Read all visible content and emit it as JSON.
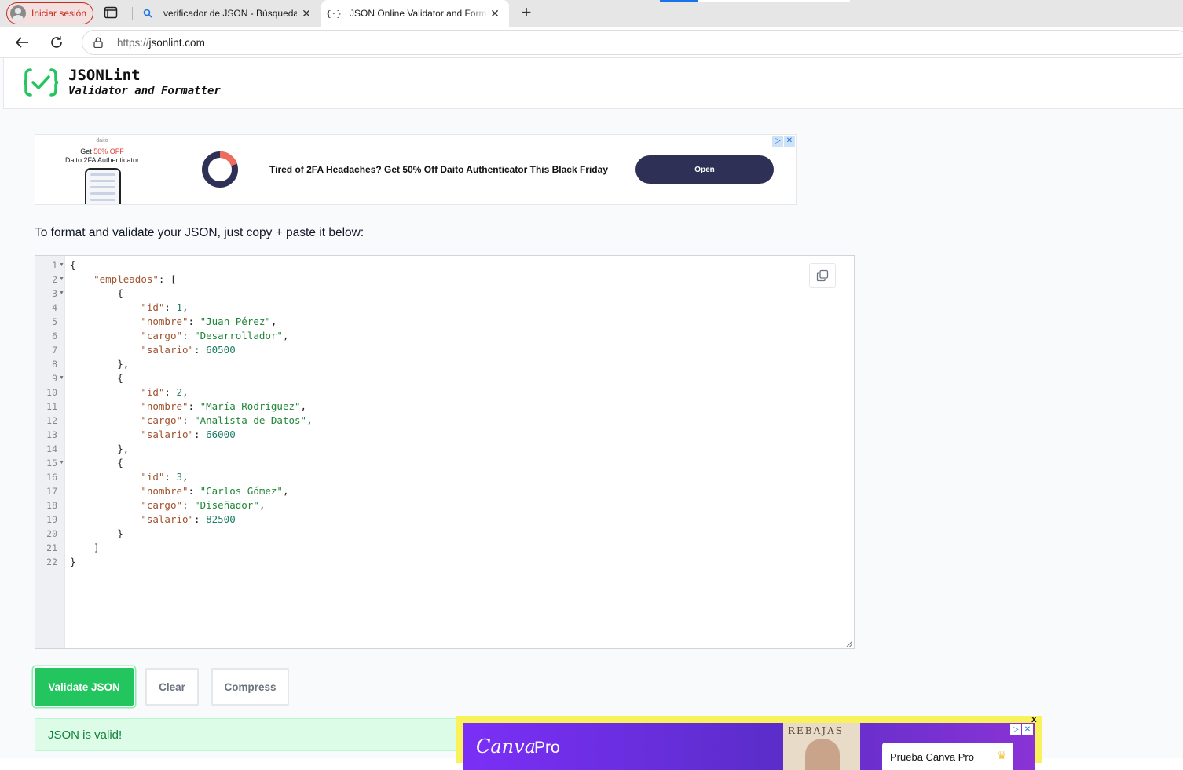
{
  "browser": {
    "profile_label": "Iniciar sesión",
    "tabs": [
      {
        "title": "verificador de JSON - Búsqueda",
        "icon": "search-icon",
        "active": false
      },
      {
        "title": "JSON Online Validator and Formatter",
        "icon": "json-braces-icon",
        "active": true
      }
    ],
    "url_scheme": "https://",
    "url_host": "jsonlint.com"
  },
  "site": {
    "name": "JSONLint",
    "tagline": "Validator and Formatter",
    "accent_color": "#22c55e"
  },
  "ad_top": {
    "brand": "daito",
    "promo_prefix": "Get ",
    "promo_highlight": "50% OFF",
    "promo_line2": "Daito 2FA Authenticator",
    "headline": "Tired of 2FA Headaches? Get 50% Off Daito Authenticator This Black Friday",
    "cta": "Open"
  },
  "instructions": "To format and validate your JSON, just copy + paste it below:",
  "editor": {
    "lines": [
      {
        "n": "1",
        "fold": true
      },
      {
        "n": "2",
        "fold": true
      },
      {
        "n": "3",
        "fold": true
      },
      {
        "n": "4"
      },
      {
        "n": "5"
      },
      {
        "n": "6"
      },
      {
        "n": "7"
      },
      {
        "n": "8"
      },
      {
        "n": "9",
        "fold": true
      },
      {
        "n": "10"
      },
      {
        "n": "11"
      },
      {
        "n": "12"
      },
      {
        "n": "13"
      },
      {
        "n": "14"
      },
      {
        "n": "15",
        "fold": true
      },
      {
        "n": "16"
      },
      {
        "n": "17"
      },
      {
        "n": "18"
      },
      {
        "n": "19"
      },
      {
        "n": "20"
      },
      {
        "n": "21"
      },
      {
        "n": "22"
      }
    ],
    "code": [
      [
        [
          "p",
          "{"
        ]
      ],
      [
        [
          "p",
          "    "
        ],
        [
          "k",
          "\"empleados\""
        ],
        [
          "p",
          ": ["
        ]
      ],
      [
        [
          "p",
          "        {"
        ]
      ],
      [
        [
          "p",
          "            "
        ],
        [
          "k",
          "\"id\""
        ],
        [
          "p",
          ": "
        ],
        [
          "n",
          "1"
        ],
        [
          "p",
          ","
        ]
      ],
      [
        [
          "p",
          "            "
        ],
        [
          "k",
          "\"nombre\""
        ],
        [
          "p",
          ": "
        ],
        [
          "s",
          "\"Juan Pérez\""
        ],
        [
          "p",
          ","
        ]
      ],
      [
        [
          "p",
          "            "
        ],
        [
          "k",
          "\"cargo\""
        ],
        [
          "p",
          ": "
        ],
        [
          "s",
          "\"Desarrollador\""
        ],
        [
          "p",
          ","
        ]
      ],
      [
        [
          "p",
          "            "
        ],
        [
          "k",
          "\"salario\""
        ],
        [
          "p",
          ": "
        ],
        [
          "n",
          "60500"
        ]
      ],
      [
        [
          "p",
          "        },"
        ]
      ],
      [
        [
          "p",
          "        {"
        ]
      ],
      [
        [
          "p",
          "            "
        ],
        [
          "k",
          "\"id\""
        ],
        [
          "p",
          ": "
        ],
        [
          "n",
          "2"
        ],
        [
          "p",
          ","
        ]
      ],
      [
        [
          "p",
          "            "
        ],
        [
          "k",
          "\"nombre\""
        ],
        [
          "p",
          ": "
        ],
        [
          "s",
          "\"María Rodríguez\""
        ],
        [
          "p",
          ","
        ]
      ],
      [
        [
          "p",
          "            "
        ],
        [
          "k",
          "\"cargo\""
        ],
        [
          "p",
          ": "
        ],
        [
          "s",
          "\"Analista de Datos\""
        ],
        [
          "p",
          ","
        ]
      ],
      [
        [
          "p",
          "            "
        ],
        [
          "k",
          "\"salario\""
        ],
        [
          "p",
          ": "
        ],
        [
          "n",
          "66000"
        ]
      ],
      [
        [
          "p",
          "        },"
        ]
      ],
      [
        [
          "p",
          "        {"
        ]
      ],
      [
        [
          "p",
          "            "
        ],
        [
          "k",
          "\"id\""
        ],
        [
          "p",
          ": "
        ],
        [
          "n",
          "3"
        ],
        [
          "p",
          ","
        ]
      ],
      [
        [
          "p",
          "            "
        ],
        [
          "k",
          "\"nombre\""
        ],
        [
          "p",
          ": "
        ],
        [
          "s",
          "\"Carlos Gómez\""
        ],
        [
          "p",
          ","
        ]
      ],
      [
        [
          "p",
          "            "
        ],
        [
          "k",
          "\"cargo\""
        ],
        [
          "p",
          ": "
        ],
        [
          "s",
          "\"Diseñador\""
        ],
        [
          "p",
          ","
        ]
      ],
      [
        [
          "p",
          "            "
        ],
        [
          "k",
          "\"salario\""
        ],
        [
          "p",
          ": "
        ],
        [
          "n",
          "82500"
        ]
      ],
      [
        [
          "p",
          "        }"
        ]
      ],
      [
        [
          "p",
          "    ]"
        ]
      ],
      [
        [
          "p",
          "}"
        ]
      ]
    ]
  },
  "buttons": {
    "validate": "Validate JSON",
    "clear": "Clear",
    "compress": "Compress"
  },
  "result": {
    "message": "JSON is valid!",
    "status": "success"
  },
  "ad_bottom": {
    "brand": "Canva",
    "product": "Pro",
    "sale": "REBAJAS",
    "cta": "Prueba Canva Pro",
    "close": "x"
  }
}
